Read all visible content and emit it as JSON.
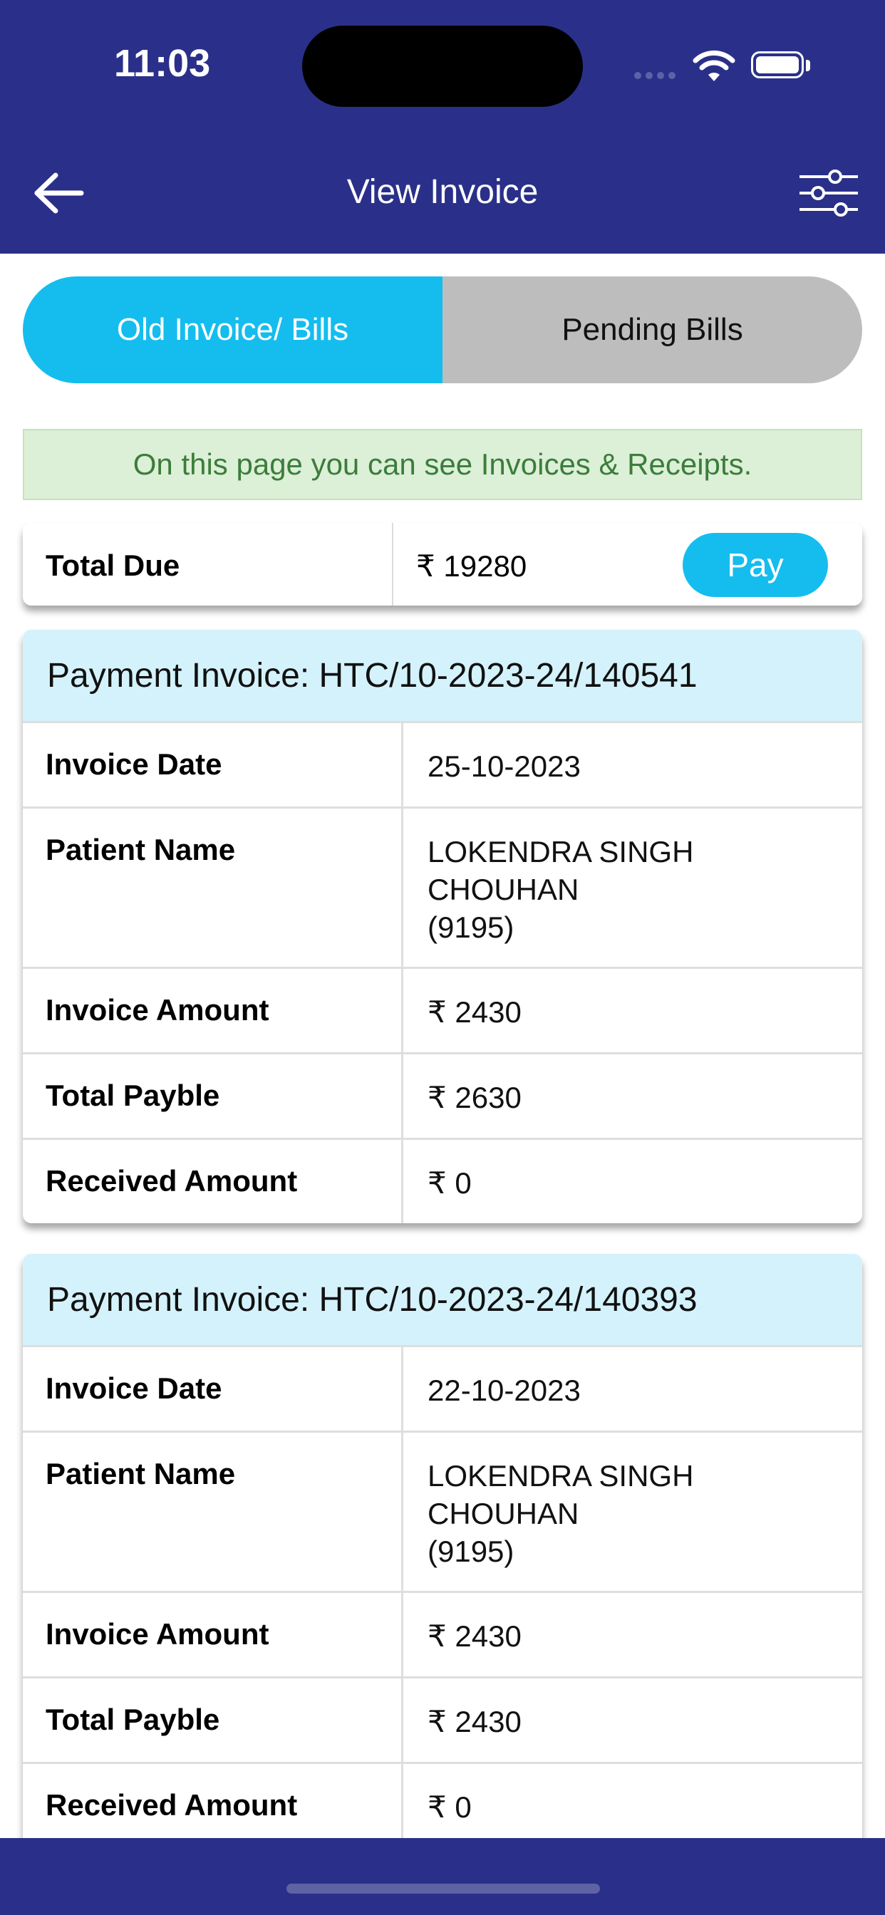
{
  "status_bar": {
    "time": "11:03"
  },
  "header": {
    "title": "View Invoice"
  },
  "tabs": [
    {
      "label": "Old Invoice/ Bills",
      "active": true
    },
    {
      "label": "Pending Bills",
      "active": false
    }
  ],
  "info_message": "On this page you can see Invoices & Receipts.",
  "total_due": {
    "label": "Total Due",
    "amount": "₹ 19280",
    "pay_label": "Pay"
  },
  "invoices": [
    {
      "title": "Payment Invoice: HTC/10-2023-24/140541",
      "rows": [
        {
          "label": "Invoice Date",
          "value": "25-10-2023"
        },
        {
          "label": "Patient Name",
          "value_lines": [
            "LOKENDRA SINGH",
            "CHOUHAN",
            "(9195)"
          ]
        },
        {
          "label": "Invoice Amount",
          "value": "₹ 2430"
        },
        {
          "label": "Total Payble",
          "value": "₹ 2630"
        },
        {
          "label": "Received Amount",
          "value": "₹ 0"
        }
      ]
    },
    {
      "title": "Payment Invoice: HTC/10-2023-24/140393",
      "rows": [
        {
          "label": "Invoice Date",
          "value": "22-10-2023"
        },
        {
          "label": "Patient Name",
          "value_lines": [
            "LOKENDRA SINGH",
            "CHOUHAN",
            "(9195)"
          ]
        },
        {
          "label": "Invoice Amount",
          "value": "₹ 2430"
        },
        {
          "label": "Total Payble",
          "value": "₹ 2430"
        },
        {
          "label": "Received Amount",
          "value": "₹ 0"
        }
      ]
    }
  ],
  "colors": {
    "primary": "#2a3089",
    "accent": "#14bdee",
    "banner_bg": "#dcefd7",
    "banner_text": "#3b7d3b"
  }
}
